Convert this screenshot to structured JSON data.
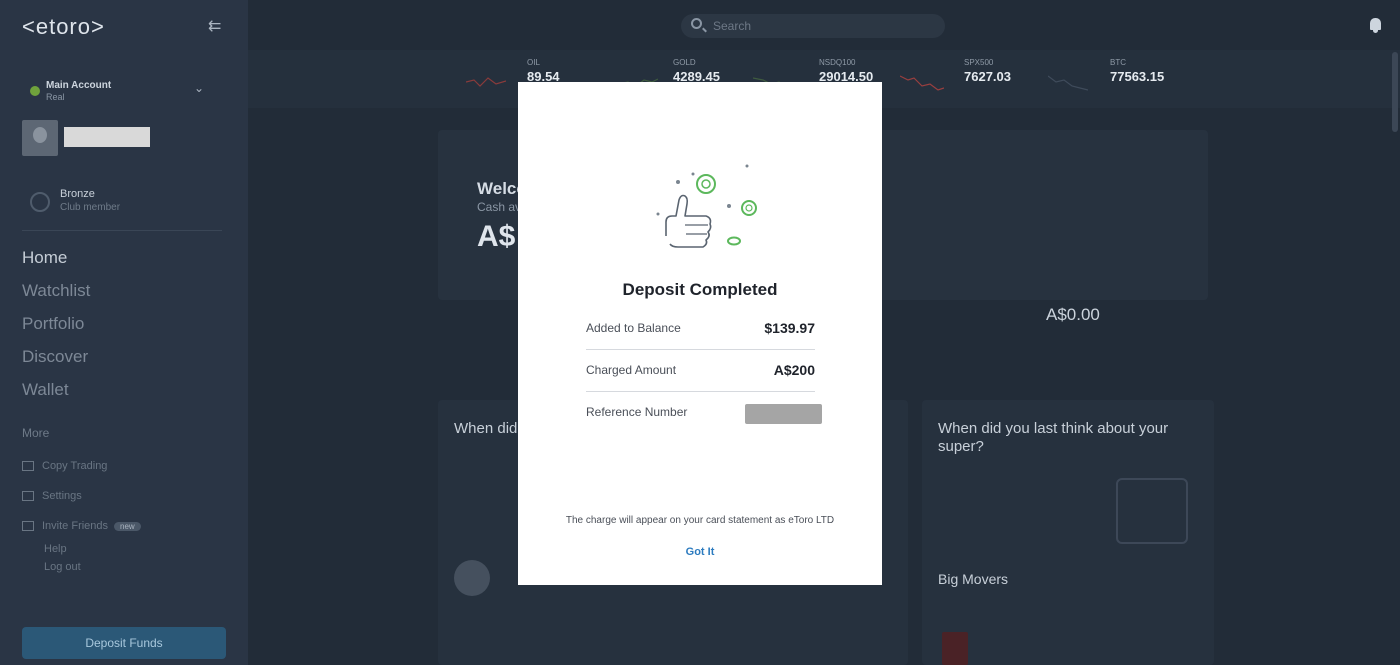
{
  "app": {
    "logo_text": "<etoro>",
    "collapse_icon": "collapse-arrow-icon"
  },
  "sidebar": {
    "account": {
      "name": "Main Account",
      "sub": "Real"
    },
    "club": {
      "label": "Bronze",
      "sub": "Club member"
    },
    "nav": [
      {
        "label": "Home"
      },
      {
        "label": "Watchlist"
      },
      {
        "label": "Portfolio"
      },
      {
        "label": "Discover"
      },
      {
        "label": "Wallet"
      }
    ],
    "more_label": "More",
    "links": [
      {
        "label": "Copy Trading"
      },
      {
        "label": "Settings"
      },
      {
        "label": "Invite Friends",
        "badge": "new"
      },
      {
        "label": "Help"
      },
      {
        "label": "Log out"
      }
    ],
    "deposit_button": "Deposit Funds"
  },
  "topbar": {
    "search_placeholder": "Search"
  },
  "tickers": [
    {
      "symbol": "OIL",
      "price": "89.54",
      "change": ""
    },
    {
      "symbol": "GOLD",
      "price": "4289.45",
      "change": ""
    },
    {
      "symbol": "NSDQ100",
      "price": "29014.50",
      "change": ""
    },
    {
      "symbol": "SPX500",
      "price": "7627.03",
      "change": ""
    },
    {
      "symbol": "BTC",
      "price": "77563.15",
      "change": ""
    }
  ],
  "dashboard": {
    "welcome_title": "Welcome",
    "welcome_sub": "Cash available",
    "welcome_amount": "A$",
    "right_amount": "A$0.00",
    "left_card_title": "When did",
    "left_card_row": "",
    "right_card_title": "When did you last think about your super?",
    "big_movers_title": "Big Movers"
  },
  "modal": {
    "title": "Deposit Completed",
    "rows": [
      {
        "label": "Added to Balance",
        "value": "$139.97"
      },
      {
        "label": "Charged Amount",
        "value": "A$200"
      },
      {
        "label": "Reference Number",
        "value": ""
      }
    ],
    "note": "The charge will appear on your card statement as eToro LTD",
    "button": "Got It",
    "colors": {
      "accent": "#2c7bbf",
      "illustration": "#5cb85c"
    }
  }
}
